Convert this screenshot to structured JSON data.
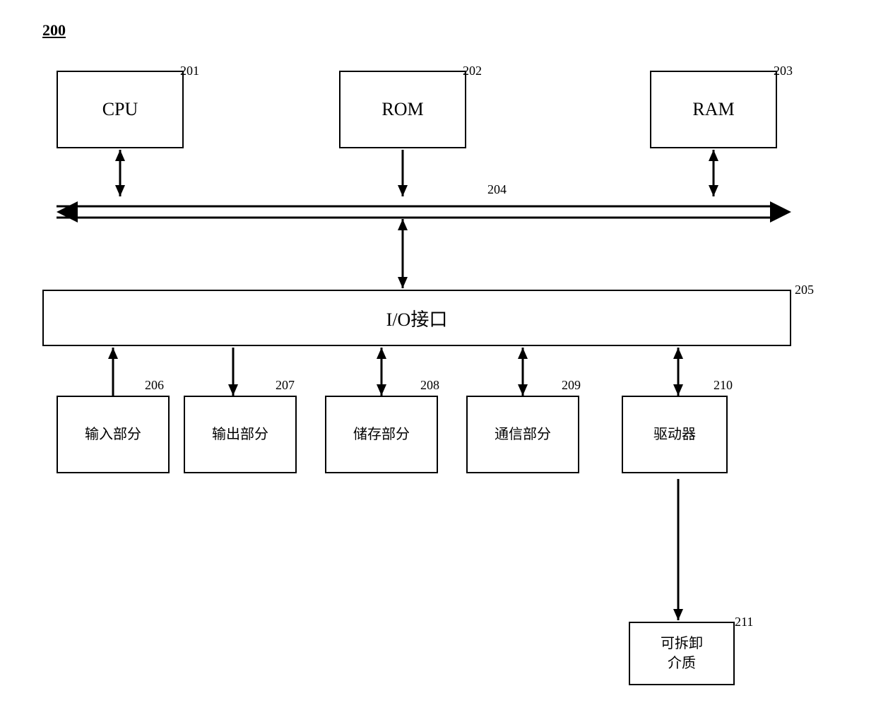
{
  "diagram": {
    "label": "200",
    "cpu": {
      "text": "CPU",
      "ref": "201"
    },
    "rom": {
      "text": "ROM",
      "ref": "202"
    },
    "ram": {
      "text": "RAM",
      "ref": "203"
    },
    "bus": {
      "ref": "204"
    },
    "io": {
      "text": "I/O接口",
      "ref": "205"
    },
    "input": {
      "text": "输入部分",
      "ref": "206"
    },
    "output": {
      "text": "输出部分",
      "ref": "207"
    },
    "storage": {
      "text": "储存部分",
      "ref": "208"
    },
    "communication": {
      "text": "通信部分",
      "ref": "209"
    },
    "driver": {
      "text": "驱动器",
      "ref": "210"
    },
    "media": {
      "text": "可拆卸\n介质",
      "ref": "211"
    }
  }
}
